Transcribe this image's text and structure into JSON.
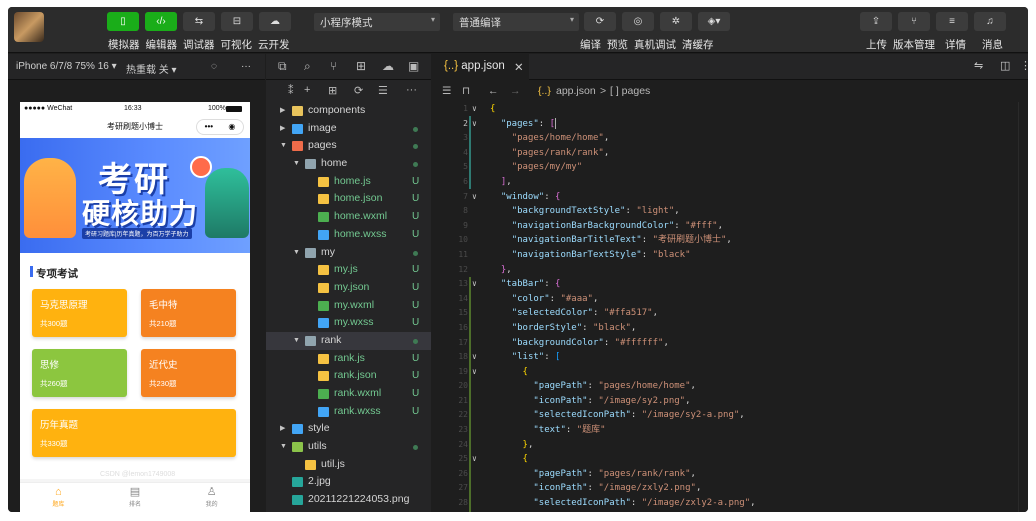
{
  "toolbar": {
    "mode_select": "小程序模式",
    "compile_select": "普通编译",
    "left_labels": [
      "模拟器",
      "编辑器",
      "调试器",
      "可视化",
      "云开发"
    ],
    "mid_labels": [
      "编译",
      "预览",
      "真机调试",
      "清缓存"
    ],
    "right_labels": [
      "上传",
      "版本管理",
      "详情",
      "消息"
    ]
  },
  "simulator": {
    "device": "iPhone 6/7/8 75% 16 ▾",
    "hotreload": "热重载 关 ▾",
    "status_carrier": "●●●●● WeChat",
    "status_time": "16:33",
    "status_battery": "100%",
    "nav_title": "考研刷题小博士",
    "capsule_dots": "•••",
    "capsule_target": "◉",
    "banner_line1": "考研",
    "banner_line2": "硬核助力",
    "banner_sub": "考研习题库|历年真题，为百万学子助力",
    "section_title": "专项考试",
    "cards": [
      {
        "name": "马克思原理",
        "count": "共300题",
        "color": "#ffb20f"
      },
      {
        "name": "毛中特",
        "count": "共210题",
        "color": "#f58220"
      },
      {
        "name": "思修",
        "count": "共260题",
        "color": "#8cc63f"
      },
      {
        "name": "近代史",
        "count": "共230题",
        "color": "#f58220"
      },
      {
        "name": "历年真题",
        "count": "共330题",
        "color": "#ffb20f"
      }
    ],
    "watermark": "CSDN @lemon1749008",
    "tabs": [
      {
        "label": "题库",
        "icon": "home-icon"
      },
      {
        "label": "排名",
        "icon": "rank-icon"
      },
      {
        "label": "我的",
        "icon": "user-icon"
      }
    ]
  },
  "explorer": {
    "items": [
      {
        "label": "components",
        "depth": 0,
        "type": "folder",
        "open": false,
        "color": "#e8c35c",
        "status": ""
      },
      {
        "label": "image",
        "depth": 0,
        "type": "folder",
        "open": false,
        "color": "#42a5f5",
        "status": "dot"
      },
      {
        "label": "pages",
        "depth": 0,
        "type": "folder",
        "open": true,
        "color": "#ef6c4a",
        "status": "dot"
      },
      {
        "label": "home",
        "depth": 1,
        "type": "folder",
        "open": true,
        "color": "#90a4ae",
        "status": "dot"
      },
      {
        "label": "home.js",
        "depth": 2,
        "type": "js",
        "color": "#f5c242",
        "status": "U"
      },
      {
        "label": "home.json",
        "depth": 2,
        "type": "json",
        "color": "#f5c242",
        "status": "U"
      },
      {
        "label": "home.wxml",
        "depth": 2,
        "type": "wxml",
        "color": "#4caf50",
        "status": "U"
      },
      {
        "label": "home.wxss",
        "depth": 2,
        "type": "wxss",
        "color": "#42a5f5",
        "status": "U"
      },
      {
        "label": "my",
        "depth": 1,
        "type": "folder",
        "open": true,
        "color": "#90a4ae",
        "status": "dot"
      },
      {
        "label": "my.js",
        "depth": 2,
        "type": "js",
        "color": "#f5c242",
        "status": "U"
      },
      {
        "label": "my.json",
        "depth": 2,
        "type": "json",
        "color": "#f5c242",
        "status": "U"
      },
      {
        "label": "my.wxml",
        "depth": 2,
        "type": "wxml",
        "color": "#4caf50",
        "status": "U"
      },
      {
        "label": "my.wxss",
        "depth": 2,
        "type": "wxss",
        "color": "#42a5f5",
        "status": "U"
      },
      {
        "label": "rank",
        "depth": 1,
        "type": "folder",
        "open": true,
        "color": "#90a4ae",
        "status": "dot",
        "selected": true
      },
      {
        "label": "rank.js",
        "depth": 2,
        "type": "js",
        "color": "#f5c242",
        "status": "U"
      },
      {
        "label": "rank.json",
        "depth": 2,
        "type": "json",
        "color": "#f5c242",
        "status": "U"
      },
      {
        "label": "rank.wxml",
        "depth": 2,
        "type": "wxml",
        "color": "#4caf50",
        "status": "U"
      },
      {
        "label": "rank.wxss",
        "depth": 2,
        "type": "wxss",
        "color": "#42a5f5",
        "status": "U"
      },
      {
        "label": "style",
        "depth": 0,
        "type": "folder",
        "open": false,
        "color": "#42a5f5",
        "status": ""
      },
      {
        "label": "utils",
        "depth": 0,
        "type": "folder",
        "open": true,
        "color": "#8bc34a",
        "status": "dot"
      },
      {
        "label": "util.js",
        "depth": 1,
        "type": "js",
        "color": "#f5c242",
        "status": ""
      },
      {
        "label": "2.jpg",
        "depth": 0,
        "type": "img",
        "color": "#26a69a",
        "status": ""
      },
      {
        "label": "20211221224053.png",
        "depth": 0,
        "type": "img",
        "color": "#26a69a",
        "status": ""
      }
    ]
  },
  "editor": {
    "tab_label": "app.json",
    "tab_icon": "{..}",
    "close": "✕",
    "breadcrumb_file": "app.json",
    "breadcrumb_sep": ">",
    "breadcrumb_path": "[ ] pages",
    "lines": [
      {
        "n": "1",
        "fold": "v",
        "t": [
          [
            "b1",
            "{"
          ]
        ]
      },
      {
        "n": "2",
        "fold": "v",
        "active": true,
        "t": [
          [
            "p",
            "  "
          ],
          [
            "k",
            "\"pages\""
          ],
          [
            "p",
            ": "
          ],
          [
            "b2",
            "["
          ],
          [
            "cursor",
            ""
          ]
        ]
      },
      {
        "n": "3",
        "t": [
          [
            "p",
            "    "
          ],
          [
            "s",
            "\"pages/home/home\""
          ],
          [
            "p",
            ","
          ]
        ]
      },
      {
        "n": "4",
        "t": [
          [
            "p",
            "    "
          ],
          [
            "s",
            "\"pages/rank/rank\""
          ],
          [
            "p",
            ","
          ]
        ]
      },
      {
        "n": "5",
        "t": [
          [
            "p",
            "    "
          ],
          [
            "s",
            "\"pages/my/my\""
          ]
        ]
      },
      {
        "n": "6",
        "t": [
          [
            "p",
            "  "
          ],
          [
            "b2",
            "]"
          ],
          [
            "p",
            ","
          ]
        ]
      },
      {
        "n": "7",
        "fold": "v",
        "t": [
          [
            "p",
            "  "
          ],
          [
            "k",
            "\"window\""
          ],
          [
            "p",
            ": "
          ],
          [
            "b2",
            "{"
          ]
        ]
      },
      {
        "n": "8",
        "t": [
          [
            "p",
            "    "
          ],
          [
            "k",
            "\"backgroundTextStyle\""
          ],
          [
            "p",
            ": "
          ],
          [
            "s",
            "\"light\""
          ],
          [
            "p",
            ","
          ]
        ]
      },
      {
        "n": "9",
        "t": [
          [
            "p",
            "    "
          ],
          [
            "k",
            "\"navigationBarBackgroundColor\""
          ],
          [
            "p",
            ": "
          ],
          [
            "s",
            "\"#fff\""
          ],
          [
            "p",
            ","
          ]
        ]
      },
      {
        "n": "10",
        "t": [
          [
            "p",
            "    "
          ],
          [
            "k",
            "\"navigationBarTitleText\""
          ],
          [
            "p",
            ": "
          ],
          [
            "s",
            "\"考研刷题小博士\""
          ],
          [
            "p",
            ","
          ]
        ]
      },
      {
        "n": "11",
        "t": [
          [
            "p",
            "    "
          ],
          [
            "k",
            "\"navigationBarTextStyle\""
          ],
          [
            "p",
            ": "
          ],
          [
            "s",
            "\"black\""
          ]
        ]
      },
      {
        "n": "12",
        "t": [
          [
            "p",
            "  "
          ],
          [
            "b2",
            "}"
          ],
          [
            "p",
            ","
          ]
        ]
      },
      {
        "n": "13",
        "fold": "v",
        "t": [
          [
            "p",
            "  "
          ],
          [
            "k",
            "\"tabBar\""
          ],
          [
            "p",
            ": "
          ],
          [
            "b2",
            "{"
          ]
        ]
      },
      {
        "n": "14",
        "t": [
          [
            "p",
            "    "
          ],
          [
            "k",
            "\"color\""
          ],
          [
            "p",
            ": "
          ],
          [
            "s",
            "\"#aaa\""
          ],
          [
            "p",
            ","
          ]
        ]
      },
      {
        "n": "15",
        "t": [
          [
            "p",
            "    "
          ],
          [
            "k",
            "\"selectedColor\""
          ],
          [
            "p",
            ": "
          ],
          [
            "s",
            "\"#ffa517\""
          ],
          [
            "p",
            ","
          ]
        ]
      },
      {
        "n": "16",
        "t": [
          [
            "p",
            "    "
          ],
          [
            "k",
            "\"borderStyle\""
          ],
          [
            "p",
            ": "
          ],
          [
            "s",
            "\"black\""
          ],
          [
            "p",
            ","
          ]
        ]
      },
      {
        "n": "17",
        "t": [
          [
            "p",
            "    "
          ],
          [
            "k",
            "\"backgroundColor\""
          ],
          [
            "p",
            ": "
          ],
          [
            "s",
            "\"#ffffff\""
          ],
          [
            "p",
            ","
          ]
        ]
      },
      {
        "n": "18",
        "fold": "v",
        "t": [
          [
            "p",
            "    "
          ],
          [
            "k",
            "\"list\""
          ],
          [
            "p",
            ": "
          ],
          [
            "b3",
            "["
          ]
        ]
      },
      {
        "n": "19",
        "fold": "v",
        "t": [
          [
            "p",
            "      "
          ],
          [
            "b1",
            "{"
          ]
        ]
      },
      {
        "n": "20",
        "t": [
          [
            "p",
            "        "
          ],
          [
            "k",
            "\"pagePath\""
          ],
          [
            "p",
            ": "
          ],
          [
            "s",
            "\"pages/home/home\""
          ],
          [
            "p",
            ","
          ]
        ]
      },
      {
        "n": "21",
        "t": [
          [
            "p",
            "        "
          ],
          [
            "k",
            "\"iconPath\""
          ],
          [
            "p",
            ": "
          ],
          [
            "s",
            "\"/image/sy2.png\""
          ],
          [
            "p",
            ","
          ]
        ]
      },
      {
        "n": "22",
        "t": [
          [
            "p",
            "        "
          ],
          [
            "k",
            "\"selectedIconPath\""
          ],
          [
            "p",
            ": "
          ],
          [
            "s",
            "\"/image/sy2-a.png\""
          ],
          [
            "p",
            ","
          ]
        ]
      },
      {
        "n": "23",
        "t": [
          [
            "p",
            "        "
          ],
          [
            "k",
            "\"text\""
          ],
          [
            "p",
            ": "
          ],
          [
            "s",
            "\"题库\""
          ]
        ]
      },
      {
        "n": "24",
        "t": [
          [
            "p",
            "      "
          ],
          [
            "b1",
            "}"
          ],
          [
            "p",
            ","
          ]
        ]
      },
      {
        "n": "25",
        "fold": "v",
        "t": [
          [
            "p",
            "      "
          ],
          [
            "b1",
            "{"
          ]
        ]
      },
      {
        "n": "26",
        "t": [
          [
            "p",
            "        "
          ],
          [
            "k",
            "\"pagePath\""
          ],
          [
            "p",
            ": "
          ],
          [
            "s",
            "\"pages/rank/rank\""
          ],
          [
            "p",
            ","
          ]
        ]
      },
      {
        "n": "27",
        "t": [
          [
            "p",
            "        "
          ],
          [
            "k",
            "\"iconPath\""
          ],
          [
            "p",
            ": "
          ],
          [
            "s",
            "\"/image/zxly2.png\""
          ],
          [
            "p",
            ","
          ]
        ]
      },
      {
        "n": "28",
        "t": [
          [
            "p",
            "        "
          ],
          [
            "k",
            "\"selectedIconPath\""
          ],
          [
            "p",
            ": "
          ],
          [
            "s",
            "\"/image/zxly2-a.png\""
          ],
          [
            "p",
            ","
          ]
        ]
      }
    ]
  }
}
